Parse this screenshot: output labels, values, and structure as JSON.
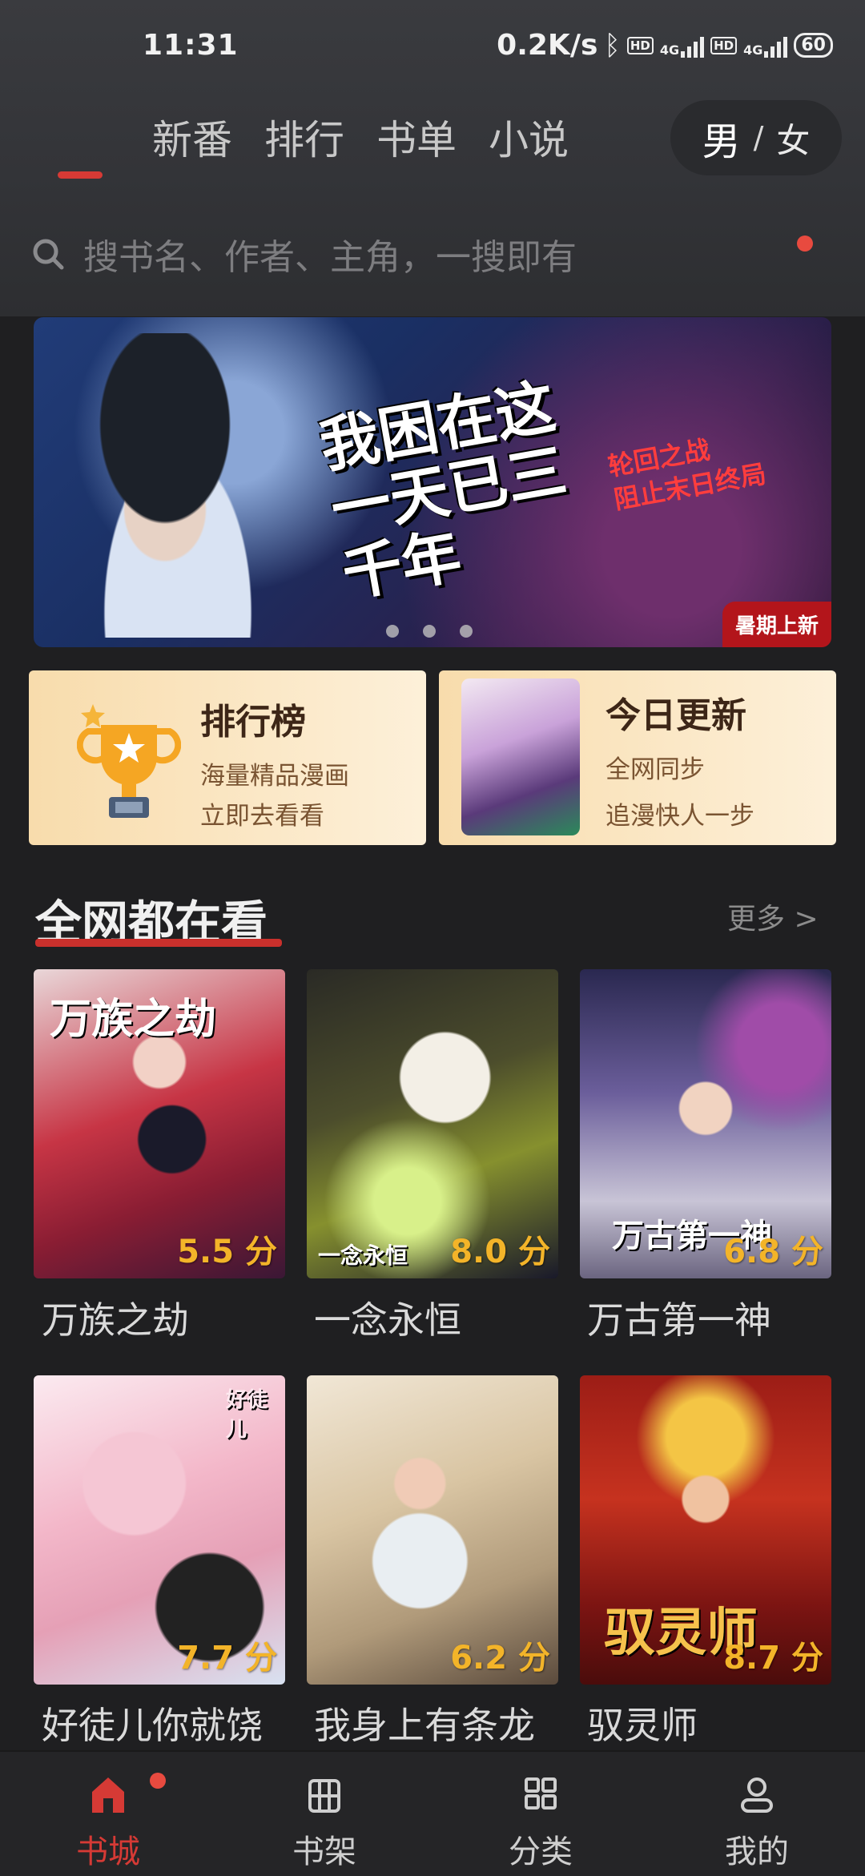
{
  "status_bar": {
    "time": "11:31",
    "net_speed": "0.2K/s",
    "bluetooth_icon": "bluetooth-icon",
    "signal_1": "4G",
    "signal_2": "4G",
    "battery": "60"
  },
  "header": {
    "tabs": [
      {
        "label": "新番"
      },
      {
        "label": "排行"
      },
      {
        "label": "书单"
      },
      {
        "label": "小说"
      }
    ],
    "active_tab_index": 0,
    "gender_toggle": {
      "male": "男",
      "separator": "/",
      "female": "女"
    },
    "search": {
      "placeholder": "搜书名、作者、主角，一搜即有"
    }
  },
  "banner": {
    "title": "我困在这一天已三千年",
    "subtitle": "轮回之战\n阻止末日终局",
    "badge": "暑期上新",
    "dots": 3
  },
  "promo_cards": [
    {
      "title": "排行榜",
      "line1": "海量精品漫画",
      "line2": "立即去看看",
      "icon": "trophy-icon"
    },
    {
      "title": "今日更新",
      "line1": "全网同步",
      "line2": "追漫快人一步",
      "icon": "comic-thumbnail"
    }
  ],
  "section": {
    "title": "全网都在看",
    "more": "更多 >"
  },
  "books": [
    {
      "name": "万族之劫",
      "score": "5.5 分",
      "cover_text": "万族之劫"
    },
    {
      "name": "一念永恒",
      "score": "8.0 分",
      "cover_text": "一念永恒"
    },
    {
      "name": "万古第一神",
      "score": "6.8 分",
      "cover_text": "万古第一神"
    },
    {
      "name": "好徒儿你就饶",
      "score": "7.7 分",
      "cover_text": "好徒儿"
    },
    {
      "name": "我身上有条龙",
      "score": "6.2 分",
      "cover_text": ""
    },
    {
      "name": "驭灵师",
      "score": "8.7 分",
      "cover_text": "驭灵师"
    }
  ],
  "bottom_nav": [
    {
      "label": "书城",
      "icon": "home-icon",
      "active": true
    },
    {
      "label": "书架",
      "icon": "bookshelf-icon",
      "active": false
    },
    {
      "label": "分类",
      "icon": "category-icon",
      "active": false
    },
    {
      "label": "我的",
      "icon": "profile-icon",
      "active": false
    }
  ],
  "colors": {
    "accent": "#d63a35",
    "score": "#f3b429",
    "background": "#1f1f21"
  }
}
